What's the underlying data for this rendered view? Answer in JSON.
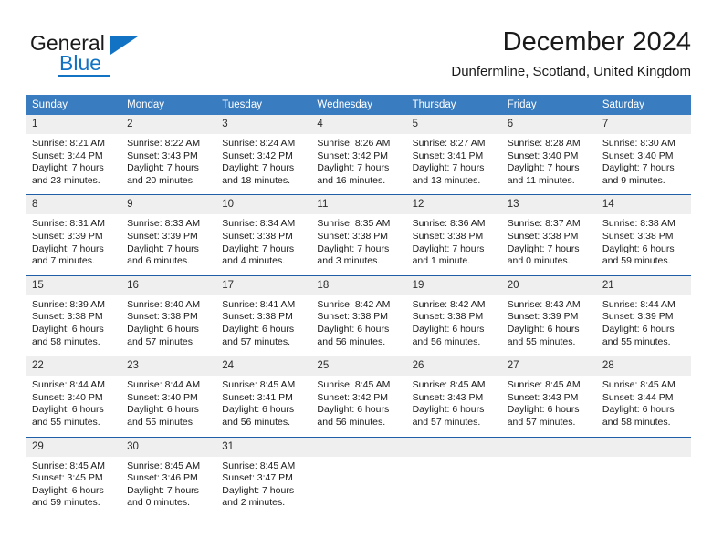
{
  "brand": {
    "name_part1": "General",
    "name_part2": "Blue",
    "logo_icon": "triangle-logo-icon",
    "accent_color": "#1273c4"
  },
  "header": {
    "title": "December 2024",
    "subtitle": "Dunfermline, Scotland, United Kingdom"
  },
  "calendar": {
    "header_bg": "#3a7cc0",
    "separator_color": "#1f5fa8",
    "daynum_bg": "#efefef",
    "weekday_headers": [
      "Sunday",
      "Monday",
      "Tuesday",
      "Wednesday",
      "Thursday",
      "Friday",
      "Saturday"
    ],
    "weeks": [
      {
        "days": [
          {
            "day": "1",
            "sunrise": "Sunrise: 8:21 AM",
            "sunset": "Sunset: 3:44 PM",
            "daylight_line1": "Daylight: 7 hours",
            "daylight_line2": "and 23 minutes."
          },
          {
            "day": "2",
            "sunrise": "Sunrise: 8:22 AM",
            "sunset": "Sunset: 3:43 PM",
            "daylight_line1": "Daylight: 7 hours",
            "daylight_line2": "and 20 minutes."
          },
          {
            "day": "3",
            "sunrise": "Sunrise: 8:24 AM",
            "sunset": "Sunset: 3:42 PM",
            "daylight_line1": "Daylight: 7 hours",
            "daylight_line2": "and 18 minutes."
          },
          {
            "day": "4",
            "sunrise": "Sunrise: 8:26 AM",
            "sunset": "Sunset: 3:42 PM",
            "daylight_line1": "Daylight: 7 hours",
            "daylight_line2": "and 16 minutes."
          },
          {
            "day": "5",
            "sunrise": "Sunrise: 8:27 AM",
            "sunset": "Sunset: 3:41 PM",
            "daylight_line1": "Daylight: 7 hours",
            "daylight_line2": "and 13 minutes."
          },
          {
            "day": "6",
            "sunrise": "Sunrise: 8:28 AM",
            "sunset": "Sunset: 3:40 PM",
            "daylight_line1": "Daylight: 7 hours",
            "daylight_line2": "and 11 minutes."
          },
          {
            "day": "7",
            "sunrise": "Sunrise: 8:30 AM",
            "sunset": "Sunset: 3:40 PM",
            "daylight_line1": "Daylight: 7 hours",
            "daylight_line2": "and 9 minutes."
          }
        ]
      },
      {
        "days": [
          {
            "day": "8",
            "sunrise": "Sunrise: 8:31 AM",
            "sunset": "Sunset: 3:39 PM",
            "daylight_line1": "Daylight: 7 hours",
            "daylight_line2": "and 7 minutes."
          },
          {
            "day": "9",
            "sunrise": "Sunrise: 8:33 AM",
            "sunset": "Sunset: 3:39 PM",
            "daylight_line1": "Daylight: 7 hours",
            "daylight_line2": "and 6 minutes."
          },
          {
            "day": "10",
            "sunrise": "Sunrise: 8:34 AM",
            "sunset": "Sunset: 3:38 PM",
            "daylight_line1": "Daylight: 7 hours",
            "daylight_line2": "and 4 minutes."
          },
          {
            "day": "11",
            "sunrise": "Sunrise: 8:35 AM",
            "sunset": "Sunset: 3:38 PM",
            "daylight_line1": "Daylight: 7 hours",
            "daylight_line2": "and 3 minutes."
          },
          {
            "day": "12",
            "sunrise": "Sunrise: 8:36 AM",
            "sunset": "Sunset: 3:38 PM",
            "daylight_line1": "Daylight: 7 hours",
            "daylight_line2": "and 1 minute."
          },
          {
            "day": "13",
            "sunrise": "Sunrise: 8:37 AM",
            "sunset": "Sunset: 3:38 PM",
            "daylight_line1": "Daylight: 7 hours",
            "daylight_line2": "and 0 minutes."
          },
          {
            "day": "14",
            "sunrise": "Sunrise: 8:38 AM",
            "sunset": "Sunset: 3:38 PM",
            "daylight_line1": "Daylight: 6 hours",
            "daylight_line2": "and 59 minutes."
          }
        ]
      },
      {
        "days": [
          {
            "day": "15",
            "sunrise": "Sunrise: 8:39 AM",
            "sunset": "Sunset: 3:38 PM",
            "daylight_line1": "Daylight: 6 hours",
            "daylight_line2": "and 58 minutes."
          },
          {
            "day": "16",
            "sunrise": "Sunrise: 8:40 AM",
            "sunset": "Sunset: 3:38 PM",
            "daylight_line1": "Daylight: 6 hours",
            "daylight_line2": "and 57 minutes."
          },
          {
            "day": "17",
            "sunrise": "Sunrise: 8:41 AM",
            "sunset": "Sunset: 3:38 PM",
            "daylight_line1": "Daylight: 6 hours",
            "daylight_line2": "and 57 minutes."
          },
          {
            "day": "18",
            "sunrise": "Sunrise: 8:42 AM",
            "sunset": "Sunset: 3:38 PM",
            "daylight_line1": "Daylight: 6 hours",
            "daylight_line2": "and 56 minutes."
          },
          {
            "day": "19",
            "sunrise": "Sunrise: 8:42 AM",
            "sunset": "Sunset: 3:38 PM",
            "daylight_line1": "Daylight: 6 hours",
            "daylight_line2": "and 56 minutes."
          },
          {
            "day": "20",
            "sunrise": "Sunrise: 8:43 AM",
            "sunset": "Sunset: 3:39 PM",
            "daylight_line1": "Daylight: 6 hours",
            "daylight_line2": "and 55 minutes."
          },
          {
            "day": "21",
            "sunrise": "Sunrise: 8:44 AM",
            "sunset": "Sunset: 3:39 PM",
            "daylight_line1": "Daylight: 6 hours",
            "daylight_line2": "and 55 minutes."
          }
        ]
      },
      {
        "days": [
          {
            "day": "22",
            "sunrise": "Sunrise: 8:44 AM",
            "sunset": "Sunset: 3:40 PM",
            "daylight_line1": "Daylight: 6 hours",
            "daylight_line2": "and 55 minutes."
          },
          {
            "day": "23",
            "sunrise": "Sunrise: 8:44 AM",
            "sunset": "Sunset: 3:40 PM",
            "daylight_line1": "Daylight: 6 hours",
            "daylight_line2": "and 55 minutes."
          },
          {
            "day": "24",
            "sunrise": "Sunrise: 8:45 AM",
            "sunset": "Sunset: 3:41 PM",
            "daylight_line1": "Daylight: 6 hours",
            "daylight_line2": "and 56 minutes."
          },
          {
            "day": "25",
            "sunrise": "Sunrise: 8:45 AM",
            "sunset": "Sunset: 3:42 PM",
            "daylight_line1": "Daylight: 6 hours",
            "daylight_line2": "and 56 minutes."
          },
          {
            "day": "26",
            "sunrise": "Sunrise: 8:45 AM",
            "sunset": "Sunset: 3:43 PM",
            "daylight_line1": "Daylight: 6 hours",
            "daylight_line2": "and 57 minutes."
          },
          {
            "day": "27",
            "sunrise": "Sunrise: 8:45 AM",
            "sunset": "Sunset: 3:43 PM",
            "daylight_line1": "Daylight: 6 hours",
            "daylight_line2": "and 57 minutes."
          },
          {
            "day": "28",
            "sunrise": "Sunrise: 8:45 AM",
            "sunset": "Sunset: 3:44 PM",
            "daylight_line1": "Daylight: 6 hours",
            "daylight_line2": "and 58 minutes."
          }
        ]
      },
      {
        "days": [
          {
            "day": "29",
            "sunrise": "Sunrise: 8:45 AM",
            "sunset": "Sunset: 3:45 PM",
            "daylight_line1": "Daylight: 6 hours",
            "daylight_line2": "and 59 minutes."
          },
          {
            "day": "30",
            "sunrise": "Sunrise: 8:45 AM",
            "sunset": "Sunset: 3:46 PM",
            "daylight_line1": "Daylight: 7 hours",
            "daylight_line2": "and 0 minutes."
          },
          {
            "day": "31",
            "sunrise": "Sunrise: 8:45 AM",
            "sunset": "Sunset: 3:47 PM",
            "daylight_line1": "Daylight: 7 hours",
            "daylight_line2": "and 2 minutes."
          },
          {
            "day": "",
            "sunrise": "",
            "sunset": "",
            "daylight_line1": "",
            "daylight_line2": ""
          },
          {
            "day": "",
            "sunrise": "",
            "sunset": "",
            "daylight_line1": "",
            "daylight_line2": ""
          },
          {
            "day": "",
            "sunrise": "",
            "sunset": "",
            "daylight_line1": "",
            "daylight_line2": ""
          },
          {
            "day": "",
            "sunrise": "",
            "sunset": "",
            "daylight_line1": "",
            "daylight_line2": ""
          }
        ]
      }
    ]
  }
}
